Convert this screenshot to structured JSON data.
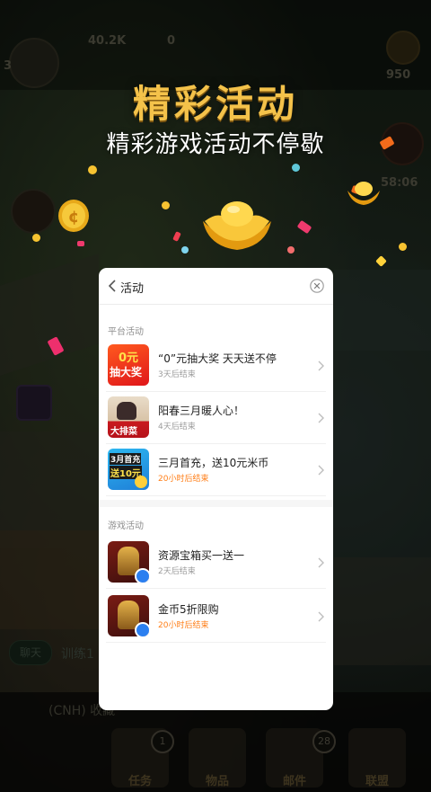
{
  "hero": {
    "title": "精彩活动",
    "subtitle": "精彩游戏活动不停歇"
  },
  "game_hud": {
    "resources": [
      {
        "value": "40.2K"
      },
      {
        "value": "0"
      },
      {
        "value": "950"
      },
      {
        "value": "58:06"
      }
    ],
    "level": "3",
    "chat_button": "聊天",
    "chat_preview": "训练1",
    "chat_line": "(CNH) 收藏",
    "bottom_tabs": [
      {
        "label": "任务",
        "badge": "1"
      },
      {
        "label": "物品",
        "badge": ""
      },
      {
        "label": "邮件",
        "badge": "28"
      },
      {
        "label": "联盟",
        "badge": ""
      }
    ]
  },
  "activity_panel": {
    "title": "活动",
    "platform_section_label": "平台活动",
    "game_section_label": "游戏活动",
    "platform_items": [
      {
        "title": "“0”元抽大奖 天天送不停",
        "subtitle": "3天后结束",
        "highlight": false,
        "thumb_lines": [
          "0元",
          "抽大奖"
        ]
      },
      {
        "title": "阳春三月暖人心！",
        "subtitle": "4天后结束",
        "highlight": false,
        "thumb_lines": [
          "大排菜"
        ]
      },
      {
        "title": "三月首充，送10元米币",
        "subtitle": "20小时后结束",
        "highlight": true,
        "thumb_lines": [
          "3月首充",
          "送10元"
        ]
      }
    ],
    "game_items": [
      {
        "title": "资源宝箱买一送一",
        "subtitle": "2天后结束",
        "highlight": false
      },
      {
        "title": "金币5折限购",
        "subtitle": "20小时后结束",
        "highlight": true
      }
    ]
  },
  "colors": {
    "accent_orange": "#ff7e17",
    "headline_gold": "#f4c24a",
    "panel_bg": "#ffffff"
  }
}
